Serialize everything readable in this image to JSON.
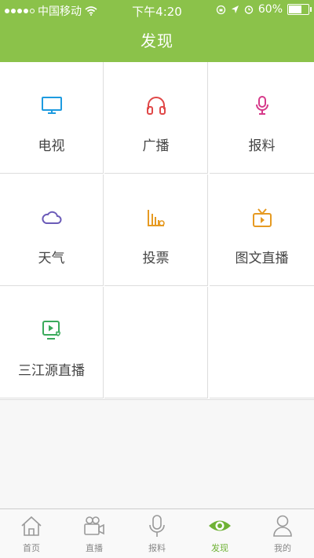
{
  "status_bar": {
    "carrier": "中国移动",
    "time": "下午4:20",
    "battery": "60%"
  },
  "header": {
    "title": "发现"
  },
  "grid": [
    {
      "label": "电视",
      "icon": "tv-icon",
      "color": "#1e9be0"
    },
    {
      "label": "广播",
      "icon": "headphones-icon",
      "color": "#e04848"
    },
    {
      "label": "报料",
      "icon": "microphone-icon",
      "color": "#d63a8a"
    },
    {
      "label": "天气",
      "icon": "cloud-icon",
      "color": "#6b5bb8"
    },
    {
      "label": "投票",
      "icon": "bar-chart-icon",
      "color": "#e69a22"
    },
    {
      "label": "图文直播",
      "icon": "retro-tv-icon",
      "color": "#e69a22"
    },
    {
      "label": "三江源直播",
      "icon": "video-play-icon",
      "color": "#3aaa5b"
    }
  ],
  "tabbar": [
    {
      "label": "首页",
      "icon": "home-icon",
      "active": false
    },
    {
      "label": "直播",
      "icon": "video-camera-icon",
      "active": false
    },
    {
      "label": "报料",
      "icon": "microphone-icon",
      "active": false
    },
    {
      "label": "发现",
      "icon": "eye-icon",
      "active": true
    },
    {
      "label": "我的",
      "icon": "user-icon",
      "active": false
    }
  ],
  "colors": {
    "header_bg": "#8bc24a",
    "active_tab": "#6fb235"
  }
}
